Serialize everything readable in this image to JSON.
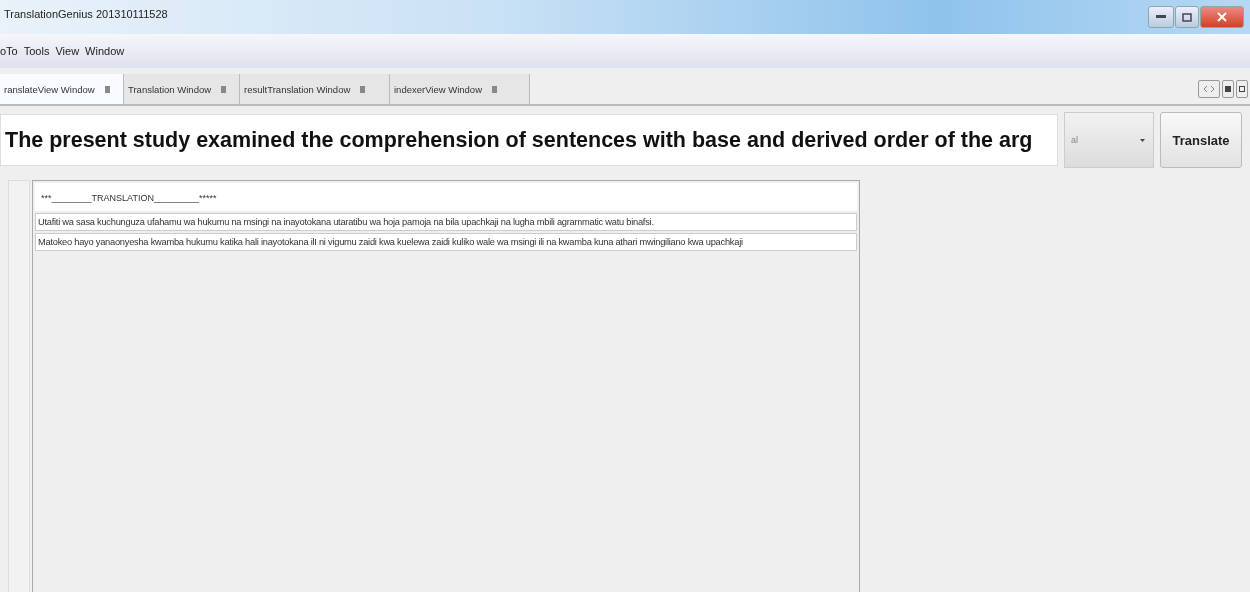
{
  "window": {
    "title": "TranslationGenius 201310111528"
  },
  "menu": [
    {
      "label": "oTo"
    },
    {
      "label": "Tools"
    },
    {
      "label": "View"
    },
    {
      "label": "Window"
    }
  ],
  "tabs": [
    {
      "label": "ranslateView Window",
      "selected": true
    },
    {
      "label": "Translation Window",
      "selected": false
    },
    {
      "label": "resultTranslation Window",
      "selected": false
    },
    {
      "label": "indexerView Window",
      "selected": false
    }
  ],
  "source": {
    "value": "The present study examined the comprehension of sentences with base and derived order of the arg"
  },
  "language": {
    "value": "al"
  },
  "translate_button": "Translate",
  "results": {
    "header": "***________TRANSLATION_________*****",
    "lines": [
      "Utafiti wa sasa kuchunguza ufahamu wa hukumu na msingi na inayotokana utaratibu wa hoja pamoja na bila upachkaji na lugha mbili agrammatic watu binafsi.",
      "Matokeo hayo yanaonyesha kwamba hukumu katika hali inayotokana ilI ni vigumu zaidi kwa kuelewa zaidi kuliko wale wa msingi ili na kwamba kuna athari mwingiliano kwa upachkaji"
    ]
  }
}
